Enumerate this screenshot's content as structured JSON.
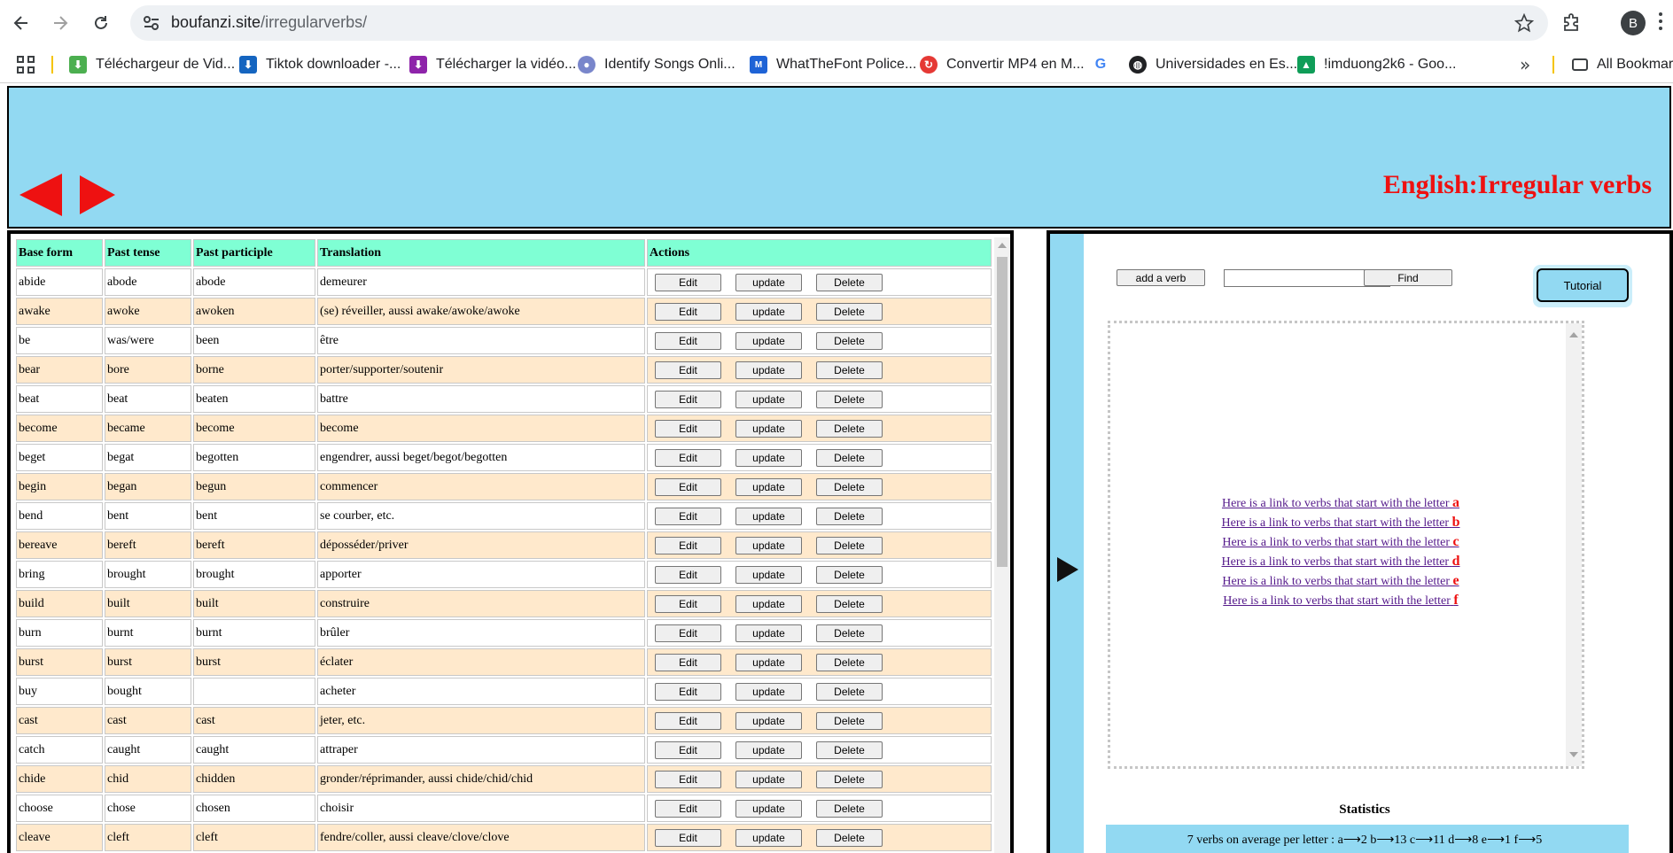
{
  "browser": {
    "url_host": "boufanzi.site",
    "url_path": "/irregularverbs/",
    "profile_initial": "B",
    "bookmarks": [
      {
        "label": "Téléchargeur de Vid...",
        "color": "#4caf50"
      },
      {
        "label": "Tiktok downloader -...",
        "color": "#1565c0"
      },
      {
        "label": "Télécharger la vidéo...",
        "color": "#8e24aa"
      },
      {
        "label": "Identify Songs Onli...",
        "color": "#7986cb"
      },
      {
        "label": "WhatTheFont Police...",
        "color": "#1e63d6"
      },
      {
        "label": "Convertir MP4 en M...",
        "color": "#e53935"
      },
      {
        "label": "",
        "color": "#4285f4"
      },
      {
        "label": "Universidades en Es...",
        "color": "#202124"
      },
      {
        "label": "!imduong2k6 - Goo...",
        "color": "#0f9d58"
      }
    ],
    "all_bookmarks": "All Bookmarks"
  },
  "header": {
    "title": "English:Irregular verbs",
    "arrow_color": "#ee1111",
    "background": "#92d9f2"
  },
  "table": {
    "columns": [
      "Base form",
      "Past tense",
      "Past participle",
      "Translation",
      "Actions"
    ],
    "actions": {
      "edit": "Edit",
      "update": "update",
      "delete": "Delete"
    },
    "rows": [
      [
        "abide",
        "abode",
        "abode",
        "demeurer"
      ],
      [
        "awake",
        "awoke",
        "awoken",
        "(se) réveiller, aussi awake/awoke/awoke"
      ],
      [
        "be",
        "was/were",
        "been",
        "être"
      ],
      [
        "bear",
        "bore",
        "borne",
        "porter/supporter/soutenir"
      ],
      [
        "beat",
        "beat",
        "beaten",
        "battre"
      ],
      [
        "become",
        "became",
        "become",
        "become"
      ],
      [
        "beget",
        "begat",
        "begotten",
        "engendrer, aussi beget/begot/begotten"
      ],
      [
        "begin",
        "began",
        "begun",
        "commencer"
      ],
      [
        "bend",
        "bent",
        "bent",
        "se courber, etc."
      ],
      [
        "bereave",
        "bereft",
        "bereft",
        "déposséder/priver"
      ],
      [
        "bring",
        "brought",
        "brought",
        "apporter"
      ],
      [
        "build",
        "built",
        "built",
        "construire"
      ],
      [
        "burn",
        "burnt",
        "burnt",
        "brûler"
      ],
      [
        "burst",
        "burst",
        "burst",
        "éclater"
      ],
      [
        "buy",
        "bought",
        "",
        "acheter"
      ],
      [
        "cast",
        "cast",
        "cast",
        "jeter, etc."
      ],
      [
        "catch",
        "caught",
        "caught",
        "attraper"
      ],
      [
        "chide",
        "chid",
        "chidden",
        "gronder/réprimander, aussi chide/chid/chid"
      ],
      [
        "choose",
        "chose",
        "chosen",
        "choisir"
      ],
      [
        "cleave",
        "cleft",
        "cleft",
        "fendre/coller, aussi cleave/clove/clove"
      ]
    ]
  },
  "sidebar": {
    "add_verb": "add a verb",
    "find_placeholder": "",
    "find": "Find",
    "tutorial": "Tutorial",
    "link_prefix": "Here is a link to verbs that start with the letter",
    "letters": [
      "a",
      "b",
      "c",
      "d",
      "e",
      "f"
    ],
    "stats_title": "Statistics",
    "stats_text": "7 verbs on average per letter : a⟶2 b⟶13 c⟶11 d⟶8 e⟶1 f⟶5"
  }
}
